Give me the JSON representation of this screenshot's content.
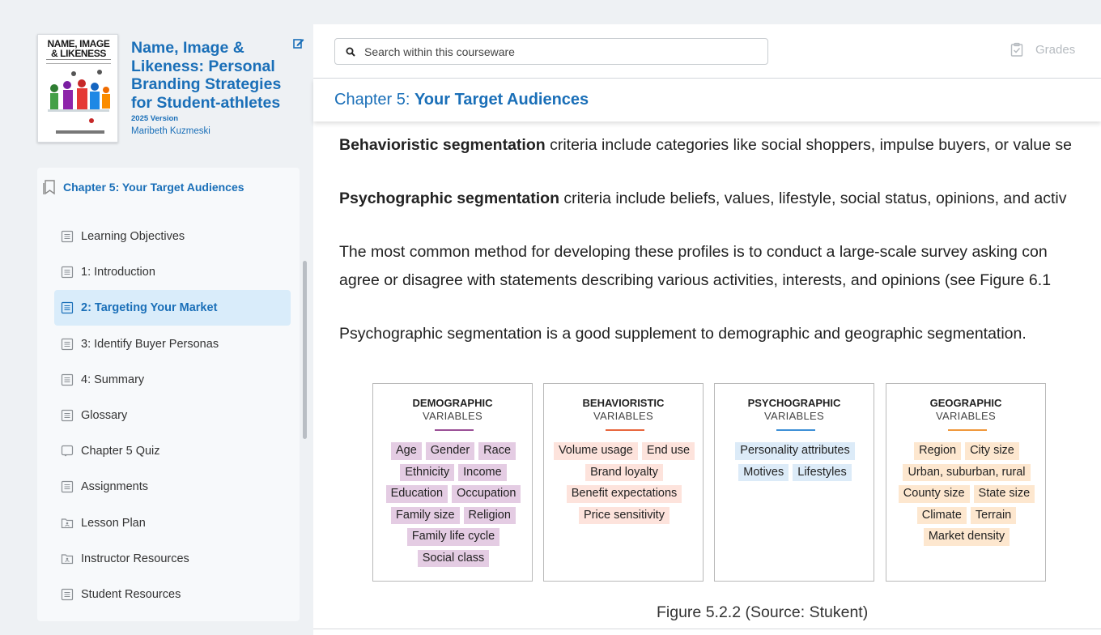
{
  "book": {
    "cover_title": "NAME, IMAGE & LIKENESS",
    "title": "Name, Image & Likeness: Personal Branding Strategies for Student-athletes",
    "version": "2025 Version",
    "author": "Maribeth Kuzmeski",
    "edit_icon": "edit-icon"
  },
  "toc": {
    "chapter": "Chapter 5: Your Target Audiences",
    "items": [
      {
        "label": "Learning Objectives",
        "icon": "page-icon"
      },
      {
        "label": "1: Introduction",
        "icon": "page-icon"
      },
      {
        "label": "2: Targeting Your Market",
        "icon": "page-icon",
        "active": true
      },
      {
        "label": "3: Identify Buyer Personas",
        "icon": "page-icon"
      },
      {
        "label": "4: Summary",
        "icon": "page-icon"
      },
      {
        "label": "Glossary",
        "icon": "page-icon"
      },
      {
        "label": "Chapter 5 Quiz",
        "icon": "quiz-icon"
      },
      {
        "label": "Assignments",
        "icon": "page-icon"
      },
      {
        "label": "Lesson Plan",
        "icon": "folder-icon"
      },
      {
        "label": "Instructor Resources",
        "icon": "folder-icon"
      },
      {
        "label": "Student Resources",
        "icon": "page-icon"
      }
    ]
  },
  "search": {
    "placeholder": "Search within this courseware"
  },
  "grades_label": "Grades",
  "chapter_bar": {
    "prefix": "Chapter 5: ",
    "title": "Your Target Audiences"
  },
  "content": {
    "p1_bold": "Behavioristic segmentation",
    "p1_rest": " criteria include categories like social shoppers, impulse buyers, or value se",
    "p2_bold": "Psychographic segmentation",
    "p2_rest": " criteria include beliefs, values, lifestyle, social status, opinions, and activ",
    "p3_line1": "The most common method for developing these profiles is to conduct a large-scale survey asking con",
    "p3_line2": "agree or disagree with statements describing various activities, interests, and opinions (see Figure 6.1",
    "p4": "Psychographic segmentation is a good supplement to demographic and geographic segmentation."
  },
  "figure": {
    "caption": "Figure 5.2.2 (Source: Stukent)",
    "boxes": [
      {
        "title": "DEMOGRAPHIC",
        "subtitle": "VARIABLES",
        "color": "#e4cce3",
        "accent": "#9b4f96",
        "tags": [
          "Age",
          "Gender",
          "Race",
          "Ethnicity",
          "Income",
          "Education",
          "Occupation",
          "Family size",
          "Religion",
          "Family life cycle",
          "Social class"
        ]
      },
      {
        "title": "BEHAVIORISTIC",
        "subtitle": "VARIABLES",
        "color": "#fde3dc",
        "accent": "#e8663d",
        "tags": [
          "Volume usage",
          "End use",
          "Brand loyalty",
          "Benefit expectations",
          "Price sensitivity"
        ]
      },
      {
        "title": "PSYCHOGRAPHIC",
        "subtitle": "VARIABLES",
        "color": "#dcebf8",
        "accent": "#3d8fd6",
        "tags": [
          "Personality attributes",
          "Motives",
          "Lifestyles"
        ]
      },
      {
        "title": "GEOGRAPHIC",
        "subtitle": "VARIABLES",
        "color": "#fde7cf",
        "accent": "#f0973b",
        "tags": [
          "Region",
          "City size",
          "Urban, suburban, rural",
          "County size",
          "State size",
          "Climate",
          "Terrain",
          "Market density"
        ]
      }
    ]
  }
}
